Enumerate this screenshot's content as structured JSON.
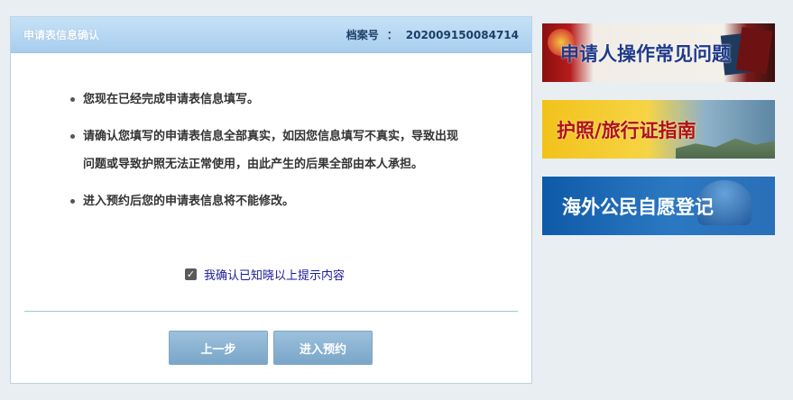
{
  "panel": {
    "title": "申请表信息确认",
    "file_label": "档案号",
    "file_sep": "：",
    "file_number": "202009150084714"
  },
  "notices": [
    "您现在已经完成申请表信息填写。",
    "请确认您填写的申请表信息全部真实，如因您信息填写不真实，导致出现问题或导致护照无法正常使用，由此产生的后果全部由本人承担。",
    "进入预约后您的申请表信息将不能修改。"
  ],
  "confirm": {
    "checked": true,
    "label": "我确认已知晓以上提示内容"
  },
  "buttons": {
    "prev": "上一步",
    "next": "进入预约"
  },
  "banners": [
    {
      "label": "申请人操作常见问题"
    },
    {
      "label": "护照/旅行证指南"
    },
    {
      "label": "海外公民自愿登记"
    }
  ],
  "colors": {
    "header_bg": "#a7cdee",
    "button_bg": "#7aa6c8",
    "confirm_text": "#1a1a9a"
  }
}
